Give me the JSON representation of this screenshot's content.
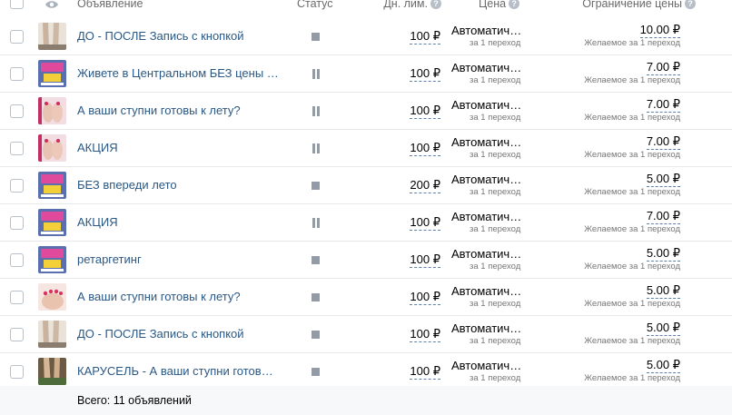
{
  "header": {
    "ad_label": "Объявление",
    "status_label": "Статус",
    "daily_limit_label": "Дн. лим.",
    "price_label": "Цена",
    "price_cap_label": "Ограничение цены",
    "eye_icon": "eye-icon",
    "help_icon": "question-circle-icon"
  },
  "colors": {
    "link": "#2a5885",
    "status_icon": "#939ba6",
    "row_border": "#e7e8ec"
  },
  "rows": [
    {
      "thumb": "legs-beige",
      "title": "ДО - ПОСЛЕ Запись с кнопкой",
      "status": "stopped",
      "limit": "100 ₽",
      "price": "Автоматич…",
      "price_sub": "за 1 переход",
      "cap": "10.00 ₽",
      "cap_sub": "Желаемое за 1 переход"
    },
    {
      "thumb": "blue-poster",
      "title": "Живете в Центральном БЕЗ цены з...",
      "status": "paused",
      "limit": "100 ₽",
      "price": "Автоматич…",
      "price_sub": "за 1 переход",
      "cap": "7.00 ₽",
      "cap_sub": "Желаемое за 1 переход"
    },
    {
      "thumb": "pink-feet",
      "title": "А ваши ступни готовы к лету?",
      "status": "paused",
      "limit": "100 ₽",
      "price": "Автоматич…",
      "price_sub": "за 1 переход",
      "cap": "7.00 ₽",
      "cap_sub": "Желаемое за 1 переход"
    },
    {
      "thumb": "pink-feet",
      "title": "АКЦИЯ",
      "status": "paused",
      "limit": "100 ₽",
      "price": "Автоматич…",
      "price_sub": "за 1 переход",
      "cap": "7.00 ₽",
      "cap_sub": "Желаемое за 1 переход"
    },
    {
      "thumb": "blue-poster",
      "title": "БЕЗ впереди лето",
      "status": "stopped",
      "limit": "200 ₽",
      "price": "Автоматич…",
      "price_sub": "за 1 переход",
      "cap": "5.00 ₽",
      "cap_sub": "Желаемое за 1 переход"
    },
    {
      "thumb": "blue-poster",
      "title": "АКЦИЯ",
      "status": "paused",
      "limit": "100 ₽",
      "price": "Автоматич…",
      "price_sub": "за 1 переход",
      "cap": "7.00 ₽",
      "cap_sub": "Желаемое за 1 переход"
    },
    {
      "thumb": "blue-poster",
      "title": "ретаргетинг",
      "status": "stopped",
      "limit": "100 ₽",
      "price": "Автоматич…",
      "price_sub": "за 1 переход",
      "cap": "5.00 ₽",
      "cap_sub": "Желаемое за 1 переход"
    },
    {
      "thumb": "pink-toes",
      "title": "А ваши ступни готовы к лету?",
      "status": "stopped",
      "limit": "100 ₽",
      "price": "Автоматич…",
      "price_sub": "за 1 переход",
      "cap": "5.00 ₽",
      "cap_sub": "Желаемое за 1 переход"
    },
    {
      "thumb": "legs-beige",
      "title": "ДО - ПОСЛЕ Запись с кнопкой",
      "status": "stopped",
      "limit": "100 ₽",
      "price": "Автоматич…",
      "price_sub": "за 1 переход",
      "cap": "5.00 ₽",
      "cap_sub": "Желаемое за 1 переход"
    },
    {
      "thumb": "brown-legs",
      "title": "КАРУСЕЛЬ - А ваши ступни готовы ...",
      "status": "stopped",
      "limit": "100 ₽",
      "price": "Автоматич…",
      "price_sub": "за 1 переход",
      "cap": "5.00 ₽",
      "cap_sub": "Желаемое за 1 переход"
    }
  ],
  "footer": {
    "total": "Всего: 11 объявлений"
  }
}
